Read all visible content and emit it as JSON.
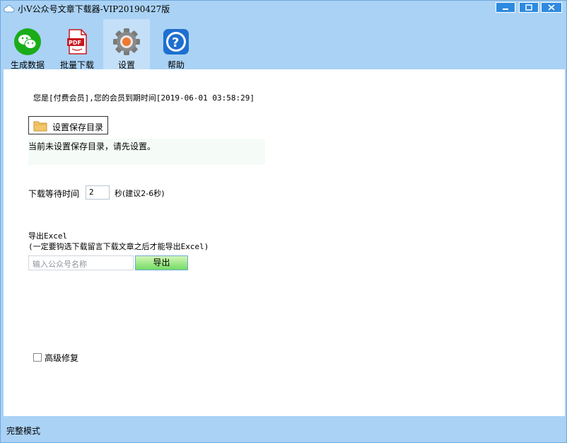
{
  "window": {
    "title": "小V公众号文章下载器-VIP20190427版",
    "accent_color": "#2e8ae0",
    "frame_color": "#aad2f5"
  },
  "toolbar": {
    "items": [
      {
        "label": "生成数据",
        "icon": "wechat-icon"
      },
      {
        "label": "批量下载",
        "icon": "pdf-icon"
      },
      {
        "label": "设置",
        "icon": "gear-icon",
        "active": true
      },
      {
        "label": "帮助",
        "icon": "help-icon"
      }
    ]
  },
  "settings": {
    "member_status": "您是[付费会员],您的会员到期时间[2019-06-01 03:58:29]",
    "set_dir_button": "设置保存目录",
    "dir_status": "当前未设置保存目录，请先设置。",
    "wait_label": "下载等待时间",
    "wait_value": "2",
    "wait_hint": "秒(建议2-6秒)",
    "export_title": "导出Excel",
    "export_note": "(一定要钩选下载留言下载文章之后才能导出Excel)",
    "account_placeholder": "输入公众号名称",
    "export_button": "导出",
    "advanced_repair_label": "高级修复",
    "advanced_repair_checked": false
  },
  "status": {
    "text": "完整模式"
  }
}
